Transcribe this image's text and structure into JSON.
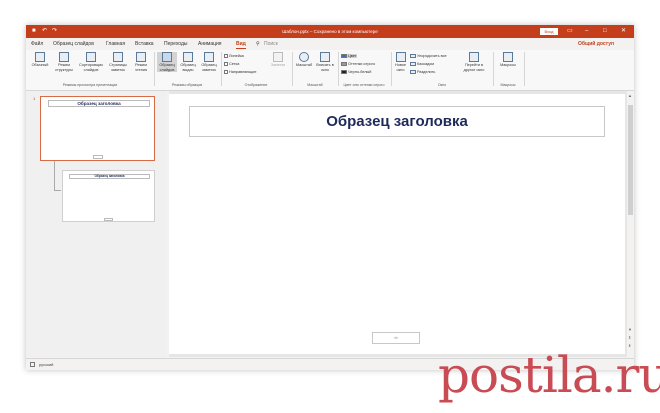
{
  "titlebar": {
    "doc_title": "Шаблон.pptx – Сохранено в этом компьютере",
    "signin_label": "Вход",
    "minimize": "–",
    "maximize": "□",
    "close": "✕",
    "layout_icon": "▭"
  },
  "menu": {
    "tabs": [
      "Файл",
      "Образец слайдов",
      "Главная",
      "Вставка",
      "Переходы",
      "Анимация",
      "Вид",
      "Поиск"
    ],
    "active_tab": "Вид",
    "share": "Общий доступ"
  },
  "ribbon": {
    "views": [
      "Обычный",
      "Режим структуры",
      "Сортировщик слайдов",
      "Страницы заметок",
      "Режим чтения"
    ],
    "views_group": "Режимы просмотра презентации",
    "masters": [
      "Образец слайдов",
      "Образец выдач",
      "Образец заметок"
    ],
    "masters_group": "Режимы образцов",
    "show": [
      "Линейка",
      "Сетка",
      "Направляющие"
    ],
    "notes_btn": "Заметки",
    "show_group": "Отображение",
    "zoom": [
      "Масштаб",
      "Вписать в окно"
    ],
    "zoom_group": "Масштаб",
    "color_opts": [
      "Цвет",
      "Оттенки серого",
      "Черно-белый"
    ],
    "color_group": "Цвет или оттенки серого",
    "new_window": "Новое окно",
    "window_opts": [
      "Упорядочить все",
      "Каскадом",
      "Разделить"
    ],
    "switch_window": "Перейти в другое окно",
    "window_group": "Окно",
    "macros": "Макросы",
    "macros_group": "Макросы"
  },
  "thumbs": {
    "num": "1",
    "title1": "Образец заголовка",
    "title2": "Образец заголовка"
  },
  "slide": {
    "title": "Образец заголовка",
    "footer": "‹#›"
  },
  "status": {
    "language": "русский"
  },
  "watermark": "postila.ru",
  "colors": {
    "accent": "#c43e1c",
    "title_text": "#1f2a5a"
  }
}
